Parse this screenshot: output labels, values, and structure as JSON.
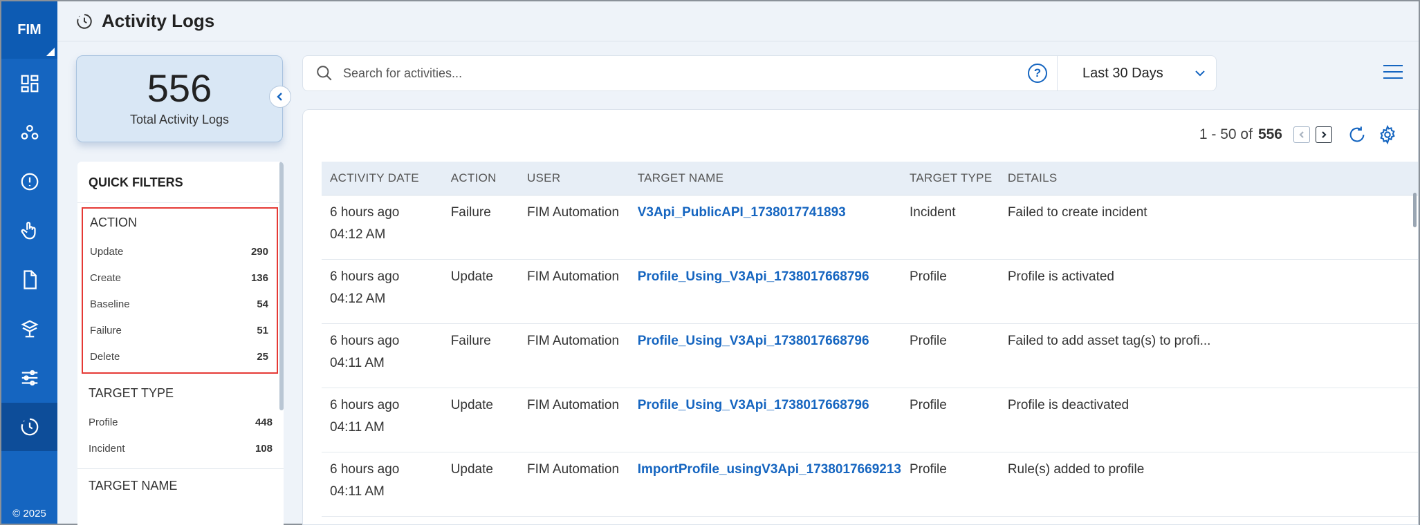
{
  "nav": {
    "logo": "FIM",
    "items": [
      {
        "icon": "dashboard-icon"
      },
      {
        "icon": "network-icon"
      },
      {
        "icon": "alert-icon"
      },
      {
        "icon": "touch-icon"
      },
      {
        "icon": "document-icon"
      },
      {
        "icon": "assets-icon"
      },
      {
        "icon": "sliders-icon"
      },
      {
        "icon": "activity-history-icon",
        "active": true
      }
    ],
    "copyright": "© 2025"
  },
  "header": {
    "title": "Activity Logs",
    "icon": "activity-history-icon"
  },
  "summary": {
    "total": "556",
    "label": "Total Activity Logs"
  },
  "filters": {
    "title": "QUICK FILTERS",
    "action": {
      "title": "ACTION",
      "items": [
        {
          "label": "Update",
          "count": "290"
        },
        {
          "label": "Create",
          "count": "136"
        },
        {
          "label": "Baseline",
          "count": "54"
        },
        {
          "label": "Failure",
          "count": "51"
        },
        {
          "label": "Delete",
          "count": "25"
        }
      ]
    },
    "target_type": {
      "title": "TARGET TYPE",
      "items": [
        {
          "label": "Profile",
          "count": "448"
        },
        {
          "label": "Incident",
          "count": "108"
        }
      ]
    },
    "target_name": {
      "title": "TARGET NAME"
    }
  },
  "search": {
    "placeholder": "Search for activities...",
    "value": ""
  },
  "date_range": {
    "selected": "Last 30 Days"
  },
  "pager": {
    "range": "1 - 50 of",
    "total": "556"
  },
  "table": {
    "columns": [
      "ACTIVITY DATE",
      "ACTION",
      "USER",
      "TARGET NAME",
      "TARGET TYPE",
      "DETAILS"
    ],
    "rows": [
      {
        "date": "6 hours ago",
        "time": "04:12 AM",
        "action": "Failure",
        "user": "FIM Automation",
        "target_name": "V3Api_PublicAPI_1738017741893",
        "target_type": "Incident",
        "details": "Failed to create incident"
      },
      {
        "date": "6 hours ago",
        "time": "04:12 AM",
        "action": "Update",
        "user": "FIM Automation",
        "target_name": "Profile_Using_V3Api_1738017668796",
        "target_type": "Profile",
        "details": "Profile is activated"
      },
      {
        "date": "6 hours ago",
        "time": "04:11 AM",
        "action": "Failure",
        "user": "FIM Automation",
        "target_name": "Profile_Using_V3Api_1738017668796",
        "target_type": "Profile",
        "details": "Failed to add asset tag(s) to profi..."
      },
      {
        "date": "6 hours ago",
        "time": "04:11 AM",
        "action": "Update",
        "user": "FIM Automation",
        "target_name": "Profile_Using_V3Api_1738017668796",
        "target_type": "Profile",
        "details": "Profile is deactivated"
      },
      {
        "date": "6 hours ago",
        "time": "04:11 AM",
        "action": "Update",
        "user": "FIM Automation",
        "target_name": "ImportProfile_usingV3Api_1738017669213",
        "target_type": "Profile",
        "details": "Rule(s) added to profile"
      }
    ]
  }
}
